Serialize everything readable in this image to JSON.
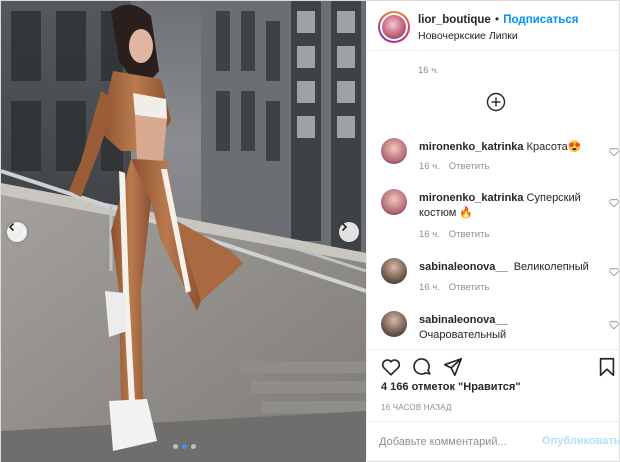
{
  "header": {
    "username": "lior_boutique",
    "separator": "•",
    "follow_label": "Подписаться",
    "location": "Новочеркские Липки"
  },
  "comments": {
    "top_time": "16 ч.",
    "load_more_icon": "plus-circle-icon",
    "items": [
      {
        "user": "mironenko_katrinka",
        "text": "Красота😍",
        "time": "16 ч.",
        "reply": "Ответить"
      },
      {
        "user": "mironenko_katrinka",
        "text": "Суперский костюм 🔥",
        "time": "16 ч.",
        "reply": "Ответить"
      },
      {
        "user": "sabinaleonova__",
        "text": "Великолепный",
        "time": "16 ч.",
        "reply": "Ответить"
      },
      {
        "user": "sabinaleonova__",
        "text": "Очаровательный",
        "time": "",
        "reply": ""
      }
    ]
  },
  "actions": {
    "like_icon": "heart-icon",
    "comment_icon": "comment-icon",
    "share_icon": "paper-plane-icon",
    "save_icon": "bookmark-icon",
    "likes": "4 166 отметок \"Нравится\"",
    "posted_ago": "16 ЧАСОВ НАЗАД"
  },
  "add_comment": {
    "placeholder": "Добавьте комментарий...",
    "publish_label": "Опубликовать"
  },
  "carousel": {
    "prev_icon": "chevron-left-icon",
    "next_icon": "chevron-right-icon",
    "slides": 3,
    "active_slide": 2
  },
  "colors": {
    "accent": "#0095f6",
    "publish_disabled": "#b2dffc",
    "muted": "#8e8e8e",
    "border": "#efefef"
  }
}
